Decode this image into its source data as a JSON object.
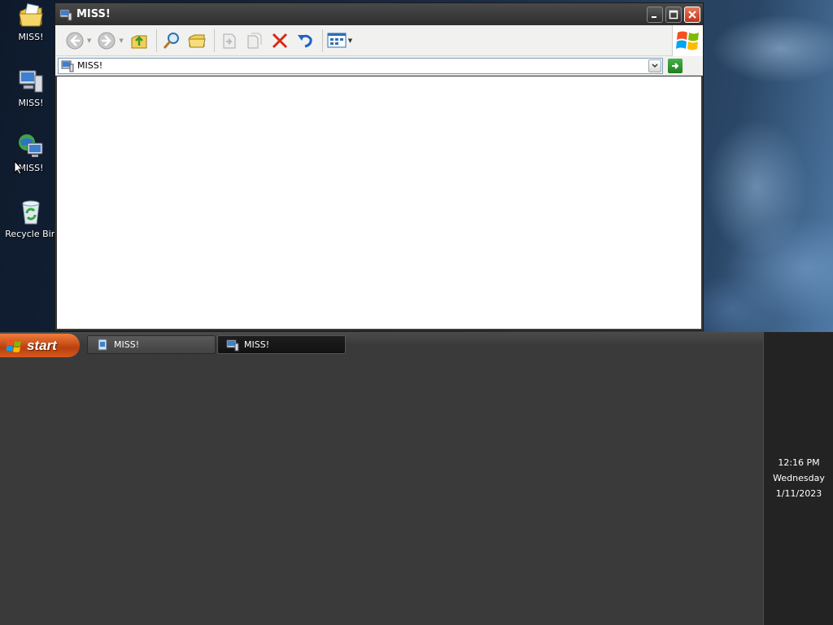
{
  "desktop": {
    "icons": [
      {
        "label": "MISS!",
        "icon": "my-documents-icon"
      },
      {
        "label": "MISS!",
        "icon": "my-computer-icon"
      },
      {
        "label": "MISS!",
        "icon": "my-network-places-icon"
      },
      {
        "label": "Recycle Bin",
        "icon": "recycle-bin-icon"
      }
    ]
  },
  "window": {
    "title": "MISS!",
    "address": {
      "value": "MISS!"
    },
    "toolbar": {
      "buttons": [
        "back-icon",
        "forward-icon",
        "up-folder-icon",
        "search-icon",
        "folders-icon",
        "move-to-icon",
        "copy-to-icon",
        "delete-icon",
        "undo-icon",
        "views-icon"
      ]
    }
  },
  "taskbar": {
    "start_label": "start",
    "tasks": [
      {
        "label": "MISS!",
        "active": false
      },
      {
        "label": "MISS!",
        "active": true
      }
    ],
    "clock": {
      "time": "12:16 PM",
      "day": "Wednesday",
      "date": "1/11/2023"
    }
  },
  "colors": {
    "start_orange": "#d45a1c",
    "taskbar_bg": "#3a3a3a",
    "go_green": "#1f7f1f",
    "close_red": "#c2331a"
  }
}
